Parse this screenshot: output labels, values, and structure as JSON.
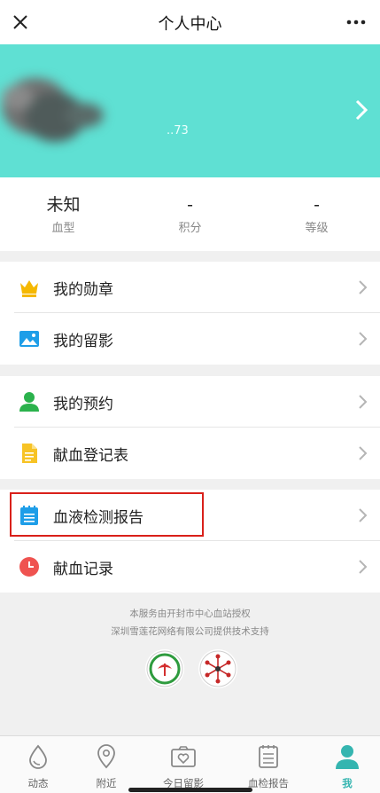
{
  "header": {
    "title": "个人中心",
    "close_icon": "close-icon",
    "more_icon": "more-dots-icon"
  },
  "profile": {
    "nickname": "..73",
    "arrow_icon": "chevron-right-icon",
    "banner_color": "#5fe0d3"
  },
  "stats": [
    {
      "value": "未知",
      "label": "血型"
    },
    {
      "value": "-",
      "label": "积分"
    },
    {
      "value": "-",
      "label": "等级"
    }
  ],
  "menu": {
    "group1": [
      {
        "label": "我的勋章",
        "icon": "crown-icon"
      },
      {
        "label": "我的留影",
        "icon": "image-icon"
      }
    ],
    "group2": [
      {
        "label": "我的预约",
        "icon": "user-icon"
      },
      {
        "label": "献血登记表",
        "icon": "document-icon"
      }
    ],
    "group3": [
      {
        "label": "血液检测报告",
        "icon": "calendar-report-icon",
        "highlighted": true
      },
      {
        "label": "献血记录",
        "icon": "clock-icon"
      }
    ]
  },
  "footer": {
    "line1": "本服务由开封市中心血站授权",
    "line2": "深圳雪莲花网络有限公司提供技术支持"
  },
  "tabs": [
    {
      "label": "动态",
      "icon": "drop-icon"
    },
    {
      "label": "附近",
      "icon": "location-pin-icon"
    },
    {
      "label": "今日留影",
      "icon": "camera-heart-icon"
    },
    {
      "label": "血检报告",
      "icon": "report-list-icon"
    },
    {
      "label": "我",
      "icon": "person-icon",
      "active": true
    }
  ],
  "colors": {
    "accent": "#35b5b0",
    "highlight_border": "#d9201a"
  }
}
